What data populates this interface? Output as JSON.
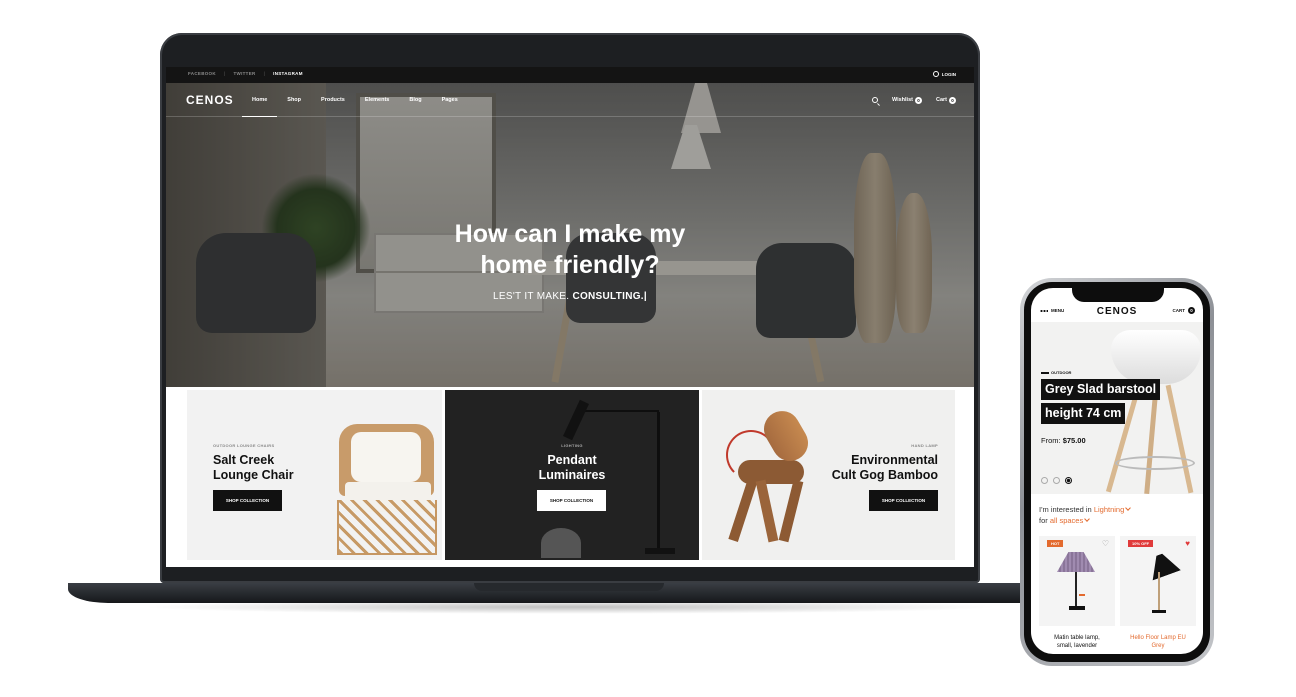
{
  "laptop": {
    "topbar": {
      "social": [
        "FACEBOOK",
        "TWITTER",
        "INSTAGRAM"
      ],
      "login": "LOGIN"
    },
    "navbar": {
      "logo": "CENOS",
      "items": [
        "Home",
        "Shop",
        "Products",
        "Elements",
        "Blog",
        "Pages"
      ],
      "active_item": "Home",
      "wishlist": {
        "label": "Wishlist",
        "count": "0"
      },
      "cart": {
        "label": "Cart",
        "count": "0"
      }
    },
    "hero": {
      "title_line1": "How can I make my",
      "title_line2": "home friendly?",
      "subtitle_prefix": "LES'T IT MAKE.",
      "subtitle_highlight": "CONSULTING.|"
    },
    "collections": [
      {
        "tag": "OUTDOOR LOUNGE CHAIRS",
        "title_line1": "Salt Creek",
        "title_line2": "Lounge Chair",
        "button": "SHOP COLLECTION"
      },
      {
        "tag": "LIGHTING",
        "title_line1": "Pendant",
        "title_line2": "Luminaires",
        "button": "SHOP COLLECTION"
      },
      {
        "tag": "HAND LAMP",
        "title_line1": "Environmental",
        "title_line2": "Cult Gog Bamboo",
        "button": "SHOP COLLECTION"
      }
    ]
  },
  "phone": {
    "header": {
      "menu": "MENU",
      "logo": "CENOS",
      "cart": "CART",
      "cart_count": "0"
    },
    "hero": {
      "tag": "OUTDOOR",
      "title_line1": "Grey Slad barstool",
      "title_line2": "height 74 cm",
      "price_label": "From:",
      "price_value": "$75.00",
      "slide_count": 3,
      "active_slide": 3
    },
    "filter": {
      "prefix": "I'm interested in",
      "category": "Lightning",
      "for_label": "for",
      "space": "all spaces"
    },
    "products": [
      {
        "badge": "HOT",
        "badge_color": "#e36a2e",
        "name_line1": "Matin table lamp,",
        "name_line2": "small, lavender",
        "wishlisted": false
      },
      {
        "badge": "10% OFF",
        "badge_color": "#e03a3a",
        "name_line1": "Hello Floor Lamp EU",
        "name_line2": "Grey",
        "wishlisted": true
      }
    ]
  },
  "colors": {
    "accent": "#e36a2e",
    "dark": "#111111",
    "sale": "#e03a3a"
  }
}
